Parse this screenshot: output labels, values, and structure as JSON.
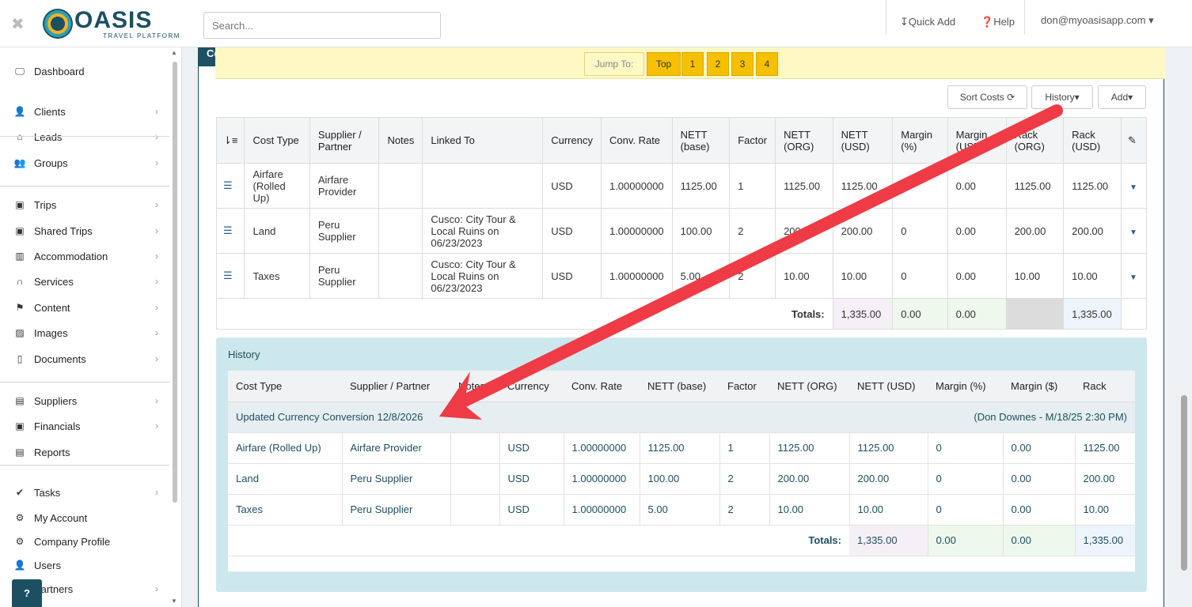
{
  "header": {
    "logo_name": "OASIS",
    "logo_sub": "TRAVEL PLATFORM",
    "search_placeholder": "Search...",
    "quick_add": "↧Quick Add",
    "help": "Help",
    "user": "don@myoasisapp.com"
  },
  "sidebar": {
    "items": [
      {
        "label": "Dashboard",
        "icon": "monitor-icon",
        "glyph": "🖵",
        "chevron": false
      },
      {
        "label": "Clients",
        "icon": "user-icon",
        "glyph": "👤",
        "chevron": true
      },
      {
        "label": "Leads",
        "icon": "inbox-icon",
        "glyph": "⌂",
        "chevron": true
      },
      {
        "label": "Groups",
        "icon": "users-icon",
        "glyph": "👥",
        "chevron": true
      },
      {
        "label": "Trips",
        "icon": "suitcase-icon",
        "glyph": "▣",
        "chevron": true
      },
      {
        "label": "Shared Trips",
        "icon": "suitcase-icon",
        "glyph": "▣",
        "chevron": true
      },
      {
        "label": "Accommodation",
        "icon": "building-icon",
        "glyph": "▥",
        "chevron": true
      },
      {
        "label": "Services",
        "icon": "binoculars-icon",
        "glyph": "∩",
        "chevron": true
      },
      {
        "label": "Content",
        "icon": "flag-icon",
        "glyph": "⚑",
        "chevron": true
      },
      {
        "label": "Images",
        "icon": "image-icon",
        "glyph": "▨",
        "chevron": true
      },
      {
        "label": "Documents",
        "icon": "pdf-icon",
        "glyph": "▯",
        "chevron": true
      },
      {
        "label": "Suppliers",
        "icon": "archive-icon",
        "glyph": "▤",
        "chevron": true
      },
      {
        "label": "Financials",
        "icon": "money-icon",
        "glyph": "▣",
        "chevron": true
      },
      {
        "label": "Reports",
        "icon": "list-alt-icon",
        "glyph": "▤",
        "chevron": false
      },
      {
        "label": "Tasks",
        "icon": "check-icon",
        "glyph": "✔",
        "chevron": true
      },
      {
        "label": "My Account",
        "icon": "gear-icon",
        "glyph": "⚙",
        "chevron": false
      },
      {
        "label": "Company Profile",
        "icon": "gears-icon",
        "glyph": "⚙",
        "chevron": false
      },
      {
        "label": "Users",
        "icon": "user-icon",
        "glyph": "👤",
        "chevron": false
      },
      {
        "label": "Partners",
        "icon": "handshake-icon",
        "glyph": "🤝",
        "chevron": true
      }
    ],
    "help_button": "?"
  },
  "panel": {
    "title": "Co",
    "jump_label": "Jump To:",
    "jump_buttons": [
      "Top",
      "1",
      "2",
      "3",
      "4"
    ],
    "sort_costs": "Sort Costs",
    "history_btn": "History",
    "add_btn": "Add"
  },
  "costs": {
    "headers": [
      "Cost Type",
      "Supplier / Partner",
      "Notes",
      "Linked To",
      "Currency",
      "Conv. Rate",
      "NETT (base)",
      "Factor",
      "NETT (ORG)",
      "NETT (USD)",
      "Margin (%)",
      "Margin (USD)",
      "Rack (ORG)",
      "Rack (USD)"
    ],
    "rows": [
      [
        "Airfare (Rolled Up)",
        "Airfare Provider",
        "",
        "",
        "USD",
        "1.00000000",
        "1125.00",
        "1",
        "1125.00",
        "1125.00",
        "",
        "0.00",
        "1125.00",
        "1125.00"
      ],
      [
        "Land",
        "Peru Supplier",
        "",
        "Cusco: City Tour & Local Ruins on 06/23/2023",
        "USD",
        "1.00000000",
        "100.00",
        "2",
        "200.00",
        "200.00",
        "0",
        "0.00",
        "200.00",
        "200.00"
      ],
      [
        "Taxes",
        "Peru Supplier",
        "",
        "Cusco: City Tour & Local Ruins on 06/23/2023",
        "USD",
        "1.00000000",
        "5.00",
        "2",
        "10.00",
        "10.00",
        "0",
        "0.00",
        "10.00",
        "10.00"
      ]
    ],
    "totals_label": "Totals:",
    "totals": {
      "nett_usd": "1,335.00",
      "margin_pct": "0.00",
      "margin_usd": "0.00",
      "rack_usd": "1,335.00"
    }
  },
  "history": {
    "title": "History",
    "headers": [
      "Cost Type",
      "Supplier / Partner",
      "Notes",
      "Currency",
      "Conv. Rate",
      "NETT (base)",
      "Factor",
      "NETT (ORG)",
      "NETT (USD)",
      "Margin (%)",
      "Margin ($)",
      "Rack"
    ],
    "group_label": "Updated Currency Conversion 12/8/2026",
    "group_meta": "(Don Downes - M/18/25 2:30 PM)",
    "rows": [
      [
        "Airfare (Rolled Up)",
        "Airfare Provider",
        "",
        "USD",
        "1.00000000",
        "1125.00",
        "1",
        "1125.00",
        "1125.00",
        "0",
        "0.00",
        "1125.00"
      ],
      [
        "Land",
        "Peru Supplier",
        "",
        "USD",
        "1.00000000",
        "100.00",
        "2",
        "200.00",
        "200.00",
        "0",
        "0.00",
        "200.00"
      ],
      [
        "Taxes",
        "Peru Supplier",
        "",
        "USD",
        "1.00000000",
        "5.00",
        "2",
        "10.00",
        "10.00",
        "0",
        "0.00",
        "10.00"
      ]
    ],
    "totals_label": "Totals:",
    "totals": {
      "nett_usd": "1,335.00",
      "margin_pct": "0.00",
      "margin_usd": "0.00",
      "rack": "1,335.00"
    }
  },
  "colors": {
    "brand": "#1d4f63",
    "jump_yellow": "#f6c000",
    "annotation_arrow": "#ee3b45"
  }
}
